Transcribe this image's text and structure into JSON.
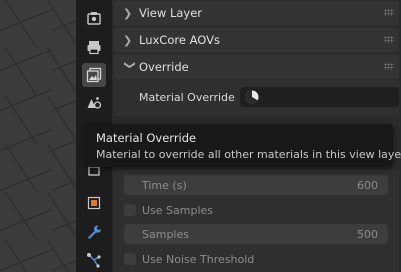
{
  "tabs": [
    {
      "icon": "render-icon",
      "active": false
    },
    {
      "icon": "output-icon",
      "active": false
    },
    {
      "icon": "view-layer-icon",
      "active": true
    },
    {
      "icon": "scene-icon",
      "active": false
    },
    {
      "icon": "world-icon",
      "active": false
    },
    {
      "icon": "object-icon",
      "active": false
    },
    {
      "icon": "modifier-wrench-icon",
      "active": false
    },
    {
      "icon": "particles-icon",
      "active": false
    }
  ],
  "sections": {
    "view_layer": {
      "label": "View Layer",
      "expanded": false
    },
    "luxcore_aovs": {
      "label": "LuxCore AOVs",
      "expanded": false
    },
    "override": {
      "label": "Override",
      "expanded": true,
      "material_override_label": "Material Override",
      "material_override_value": ""
    }
  },
  "tooltip": {
    "title": "Material Override",
    "description": "Material to override all other materials in this view layer."
  },
  "halt": {
    "time_label": "Time (s)",
    "time_value": "600",
    "use_samples_label": "Use Samples",
    "samples_label": "Samples",
    "samples_value": "500",
    "use_noise_threshold_label": "Use Noise Threshold"
  },
  "colors": {
    "panel_bg": "#2b2b2b",
    "tooltip_bg": "#181818",
    "field_bg": "#1f1f1f",
    "tab_icon": "#c8c8c8",
    "object_icon_accent": "#e07a30",
    "modifier_icon_accent": "#4f8fe0"
  }
}
